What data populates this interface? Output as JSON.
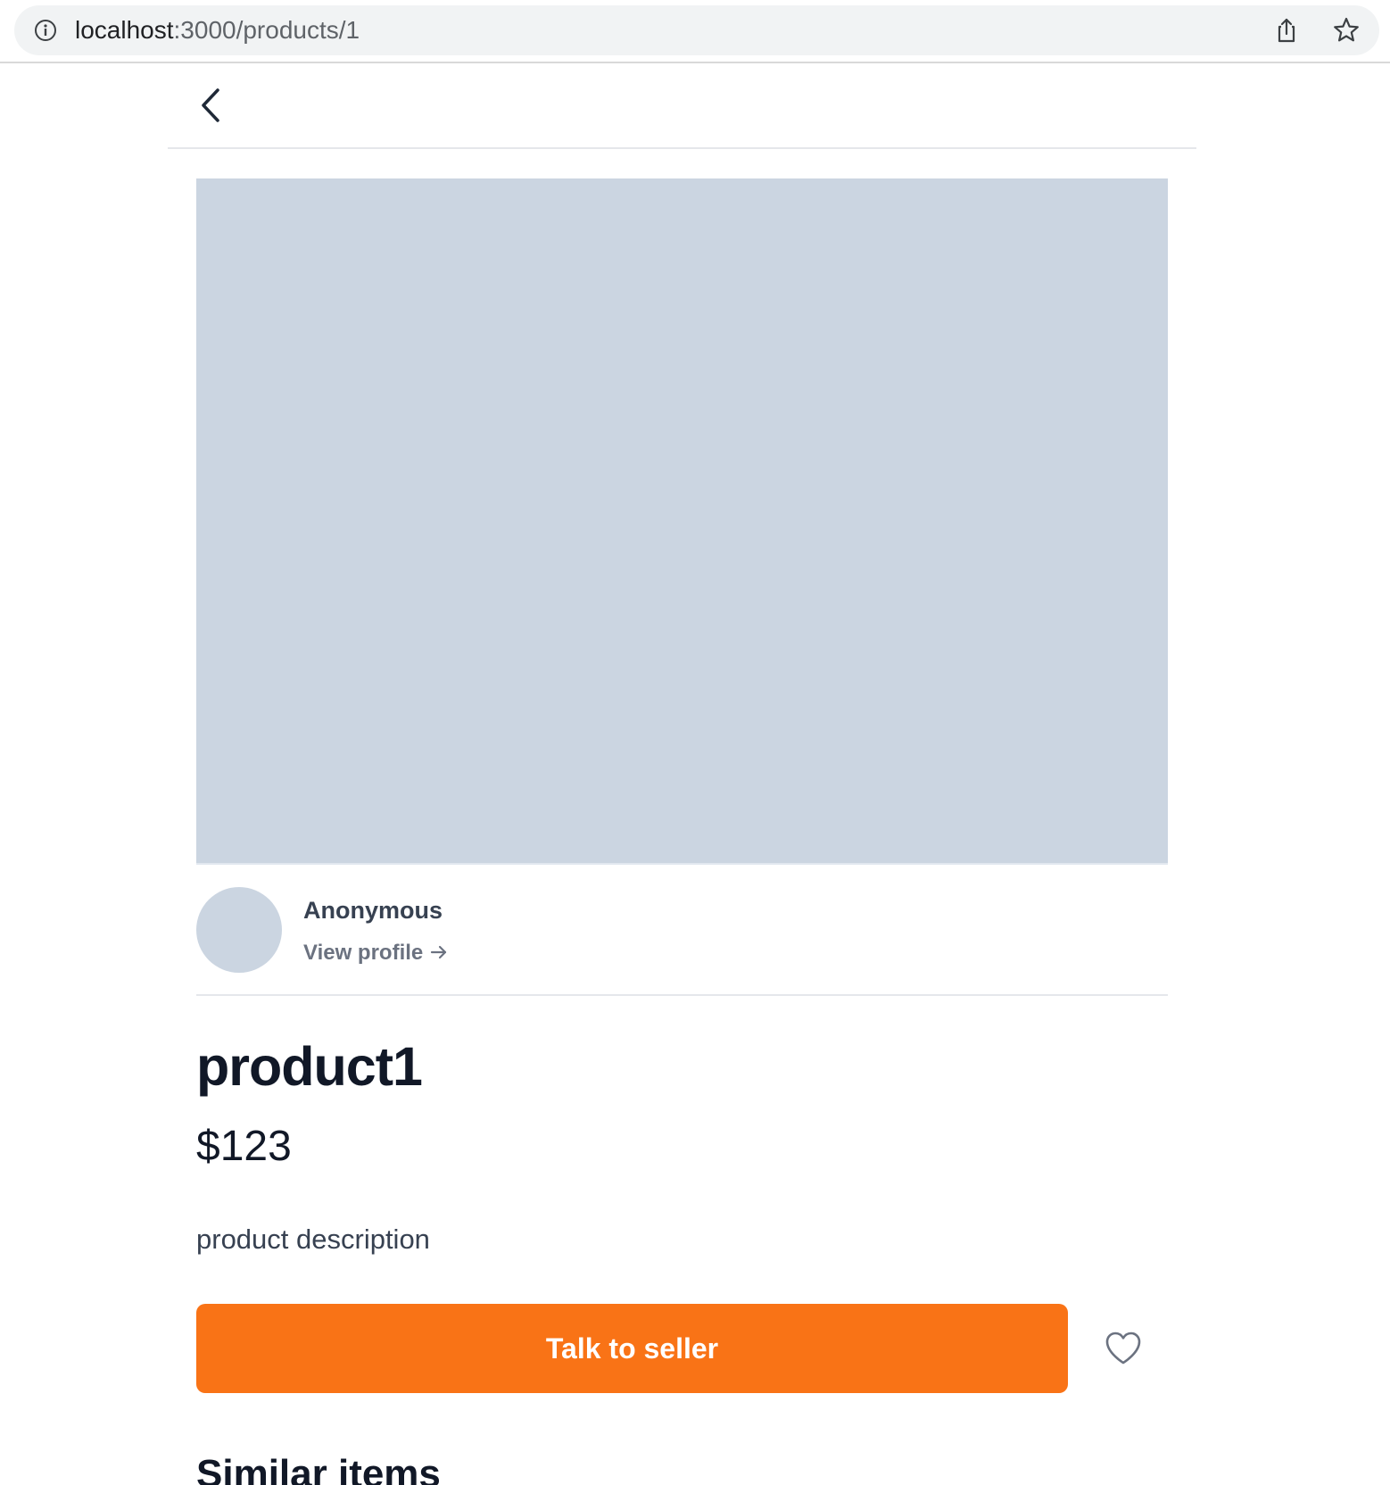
{
  "browser": {
    "url_host": "localhost",
    "url_rest": ":3000/products/1"
  },
  "seller": {
    "name": "Anonymous",
    "view_profile_label": "View profile"
  },
  "product": {
    "title": "product1",
    "price": "$123",
    "description": "product description"
  },
  "actions": {
    "talk_to_seller_label": "Talk to seller"
  },
  "similar": {
    "heading": "Similar items"
  },
  "colors": {
    "accent": "#f97316",
    "placeholder": "#cbd5e1",
    "text_primary": "#111827",
    "text_secondary": "#374151",
    "text_muted": "#6b7280"
  },
  "icons": {
    "info": "info-icon",
    "share": "share-icon",
    "bookmark": "star-icon",
    "back": "chevron-left-icon",
    "profile_arrow": "arrow-right-icon",
    "favorite": "heart-icon"
  }
}
